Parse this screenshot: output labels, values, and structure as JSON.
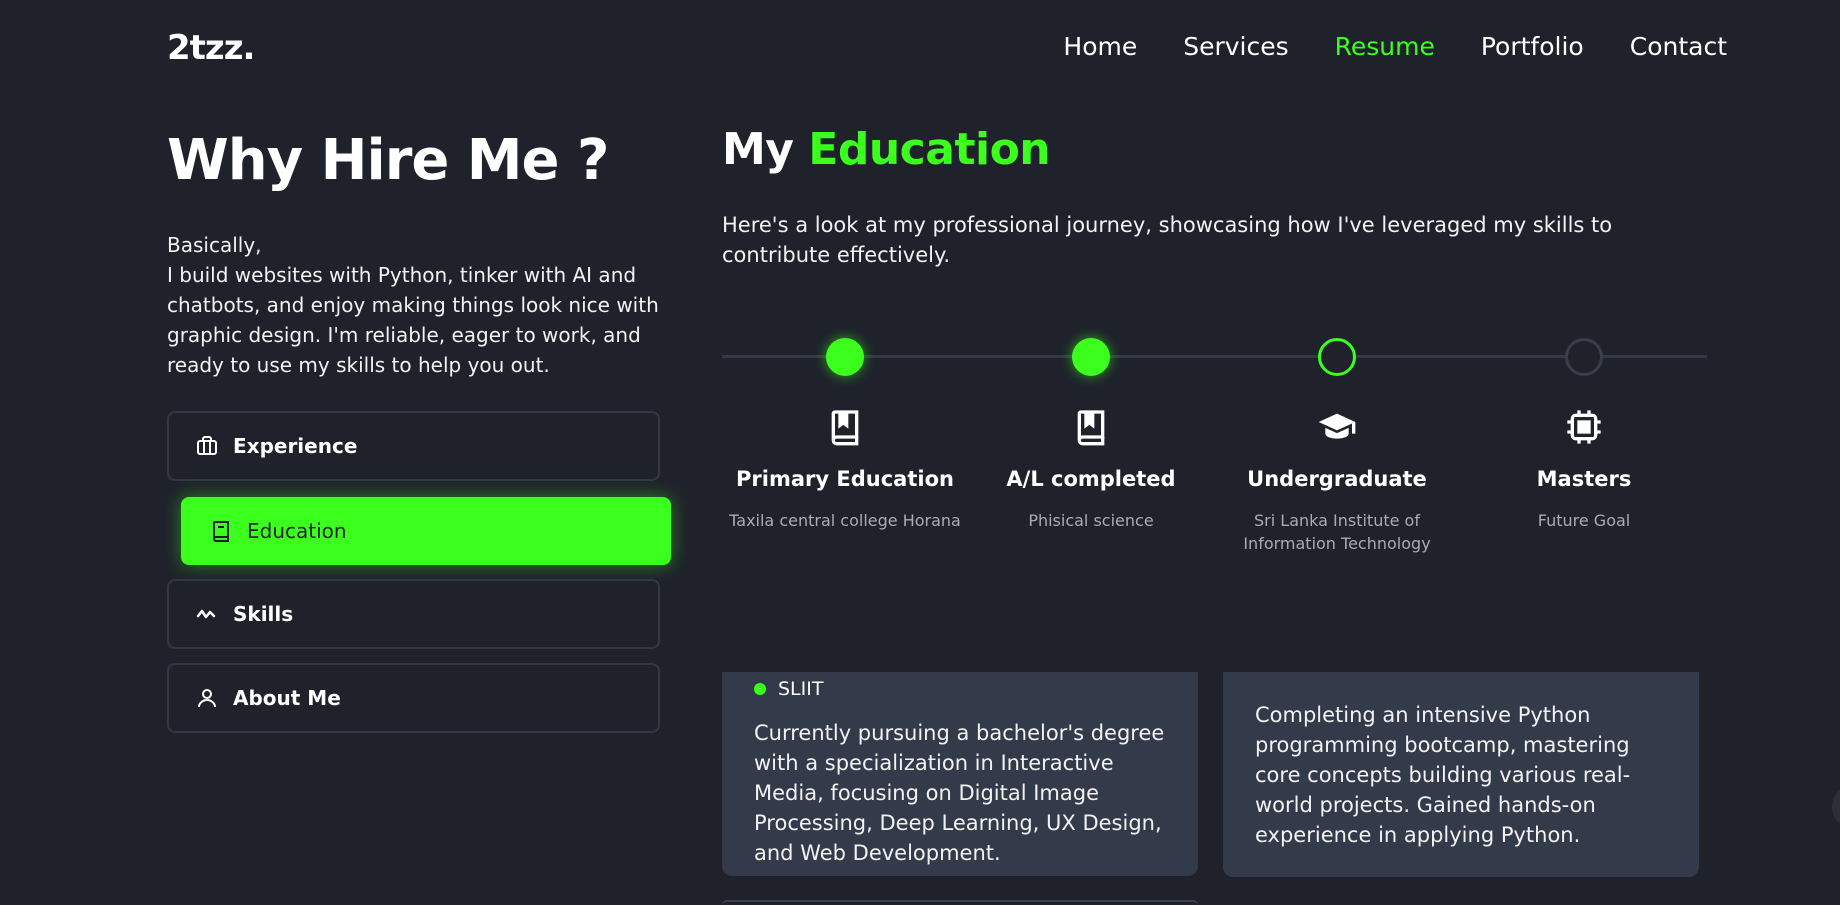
{
  "logo": "2tzz.",
  "nav": [
    {
      "label": "Home",
      "active": false
    },
    {
      "label": "Services",
      "active": false
    },
    {
      "label": "Resume",
      "active": true
    },
    {
      "label": "Portfolio",
      "active": false
    },
    {
      "label": "Contact",
      "active": false
    }
  ],
  "hire": {
    "title": "Why Hire Me ?",
    "line1": "Basically,",
    "line2": "I build websites with Python, tinker with AI and chatbots, and enjoy making things look nice with graphic design. I'm reliable, eager to work, and ready to use my skills to help you out."
  },
  "tabs": [
    {
      "label": "Experience",
      "icon": "briefcase-icon"
    },
    {
      "label": "Education",
      "icon": "book-icon",
      "active": true
    },
    {
      "label": "Skills",
      "icon": "activity-icon"
    },
    {
      "label": "About Me",
      "icon": "user-icon"
    }
  ],
  "education": {
    "title_prefix": "My",
    "title_accent": "Education",
    "description": "Here's a look at my professional journey, showcasing how I've leveraged my skills to contribute effectively.",
    "stages": [
      {
        "title": "Primary Education",
        "subtitle": "Taxila central college Horana",
        "icon": "book-icon",
        "status": "completed"
      },
      {
        "title": "A/L completed",
        "subtitle": "Phisical science",
        "icon": "book-icon",
        "status": "completed"
      },
      {
        "title": "Undergraduate",
        "subtitle": "Sri Lanka Institute of Information Technology",
        "icon": "graduation-cap-icon",
        "status": "current"
      },
      {
        "title": "Masters",
        "subtitle": "Future Goal",
        "icon": "chip-icon",
        "status": "future"
      }
    ],
    "cards": [
      {
        "institution": "SLIIT",
        "text": "Currently pursuing a bachelor's degree with a specialization in Interactive Media, focusing on Digital Image Processing, Deep Learning, UX Design, and Web Development."
      },
      {
        "text": "Completing an intensive Python programming bootcamp, mastering core concepts building various real-world projects. Gained hands-on experience in applying Python."
      }
    ]
  },
  "colors": {
    "accent": "#3bff1c",
    "background": "#1f222b",
    "card": "#333a49"
  }
}
